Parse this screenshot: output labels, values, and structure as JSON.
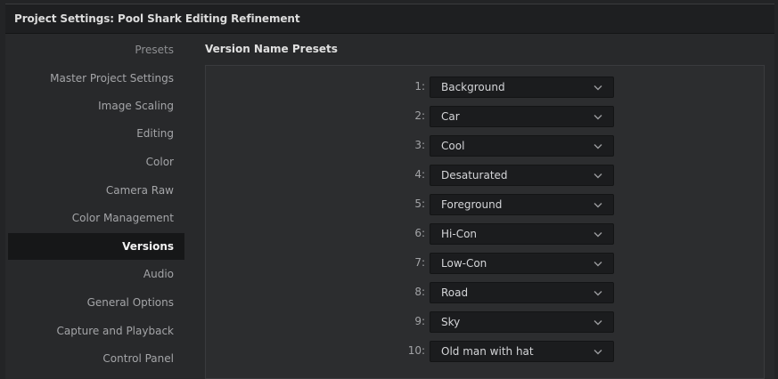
{
  "window": {
    "title": "Project Settings:  Pool Shark Editing Refinement"
  },
  "sidebar": {
    "items": [
      {
        "label": "Presets"
      },
      {
        "label": "Master Project Settings"
      },
      {
        "label": "Image Scaling"
      },
      {
        "label": "Editing"
      },
      {
        "label": "Color"
      },
      {
        "label": "Camera Raw"
      },
      {
        "label": "Color Management"
      },
      {
        "label": "Versions",
        "active": true
      },
      {
        "label": "Audio"
      },
      {
        "label": "General Options"
      },
      {
        "label": "Capture and Playback"
      },
      {
        "label": "Control Panel"
      }
    ]
  },
  "main": {
    "header": "Version Name Presets",
    "presets": [
      {
        "number": "1:",
        "value": "Background"
      },
      {
        "number": "2:",
        "value": "Car"
      },
      {
        "number": "3:",
        "value": "Cool"
      },
      {
        "number": "4:",
        "value": "Desaturated"
      },
      {
        "number": "5:",
        "value": "Foreground"
      },
      {
        "number": "6:",
        "value": "Hi-Con"
      },
      {
        "number": "7:",
        "value": "Low-Con"
      },
      {
        "number": "8:",
        "value": "Road"
      },
      {
        "number": "9:",
        "value": "Sky"
      },
      {
        "number": "10:",
        "value": "Old man with hat"
      }
    ]
  },
  "colors": {
    "active_item_bg": "#161718",
    "panel_bg": "#2c2d2f",
    "dropdown_bg": "#1b1c1e"
  }
}
